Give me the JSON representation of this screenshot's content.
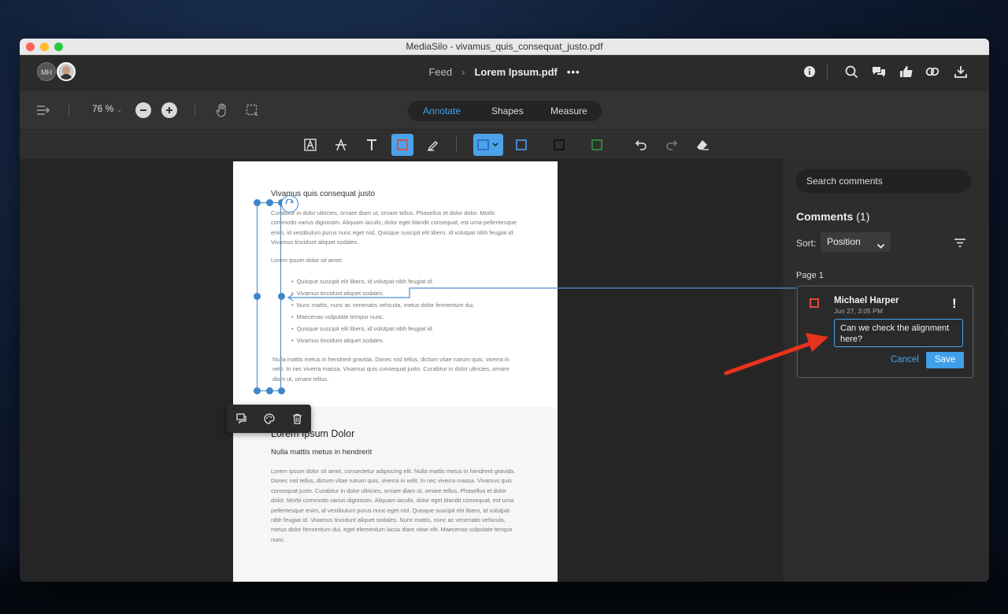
{
  "window": {
    "title": "MediaSilo - vivamus_quis_consequat_justo.pdf"
  },
  "header": {
    "avatar_initials": "MH",
    "breadcrumb_feed": "Feed",
    "breadcrumb_file": "Lorem Ipsum.pdf",
    "more": "•••"
  },
  "viewer": {
    "zoom": "76 %",
    "modes": [
      "Annotate",
      "Shapes",
      "Measure"
    ],
    "active_mode": "Annotate"
  },
  "document": {
    "p1_title": "Vivamus quis consequat justo",
    "p1_para1": "Curabitur in dolor ultricies, ornare diam ut, ornare tellus. Phasellus et dolor dolor. Morbi commodo varius dignissim. Aliquam iaculis, dolor eget blandit consequat, est urna pellentesque enim, id vestibulum purus nunc eget nisl. Quisque suscipit elit libero, id volutpat nibh feugiat id. Vivamus tincidunt aliquet sodales.",
    "p1_para2": "Lorem ipsum dolor sit amet:",
    "p1_list": [
      "Quisque suscipit elit libero, id volutpat nibh feugiat id.",
      "Vivamus tincidunt aliquet sodales.",
      "Nunc mattis, nunc ac venenatis vehicula, metus dolor fermentum dui.",
      "Maecenas vulputate tempor nunc.",
      "Quisque suscipit elit libero, id volutpat nibh feugiat id.",
      "Vivamus tincidunt aliquet sodales."
    ],
    "p1_para3": "Nulla mattis metus in hendrerit gravida. Donec nisl tellus, dictum vitae rutrum quis, viverra in velit. In nec viverra massa. Vivamus quis consequat justo. Curabitur in dolor ultricies, ornare diam ut, ornare tellus.",
    "p2_heading": "Lorem Ipsum Dolor",
    "p2_subheading": "Nulla mattis metus in hendrerit",
    "p2_para": "Lorem ipsum dolor sit amet, consectetur adipiscing elit. Nulla mattis metus in hendrerit gravida. Donec nisl tellus, dictum vitae rutrum quis, viverra in velit. In nec viverra massa. Vivamus quis consequat justo. Curabitur in dolor ultricies, ornare diam ut, ornare tellus. Phasellus et dolor dolor. Morbi commodo varius dignissim. Aliquam iaculis, dolor eget blandit consequat, est urna pellentesque enim, id vestibulum purus nunc eget nisl. Quisque suscipit elit libero, id volutpat nibh feugiat id. Vivamus tincidunt aliquet sodales. Nunc mattis, nunc ac venenatis vehicula, metus dolor fermentum dui, eget elementum lacus diam vitae elit. Maecenas vulputate tempor nunc."
  },
  "comments": {
    "search_placeholder": "Search comments",
    "heading": "Comments",
    "count": "(1)",
    "sort_label": "Sort:",
    "sort_value": "Position",
    "page_label": "Page 1",
    "items": [
      {
        "author": "Michael Harper",
        "date": "Jun 27, 3:05 PM",
        "priority": "!",
        "draft": "Can we check the alignment here?",
        "cancel": "Cancel",
        "save": "Save"
      }
    ]
  },
  "colors": {
    "accent": "#3fa0ea",
    "annotation_red": "#e04a3c",
    "selection_blue": "#3f86c9",
    "callout_arrow": "#e8321c"
  },
  "icons": [
    "info-icon",
    "search-icon",
    "comments-icon",
    "thumbs-up-icon",
    "link-icon",
    "download-icon",
    "sidebar-toggle-icon",
    "zoom-out-icon",
    "zoom-in-icon",
    "hand-icon",
    "marquee-select-icon",
    "highlight-text-icon",
    "strikethrough-icon",
    "text-icon",
    "rectangle-icon",
    "pen-icon",
    "stroke-color-icon",
    "undo-icon",
    "redo-icon",
    "eraser-icon",
    "rotate-icon",
    "reply-icon",
    "palette-icon",
    "trash-icon",
    "filter-icon",
    "chevron-down-icon"
  ]
}
